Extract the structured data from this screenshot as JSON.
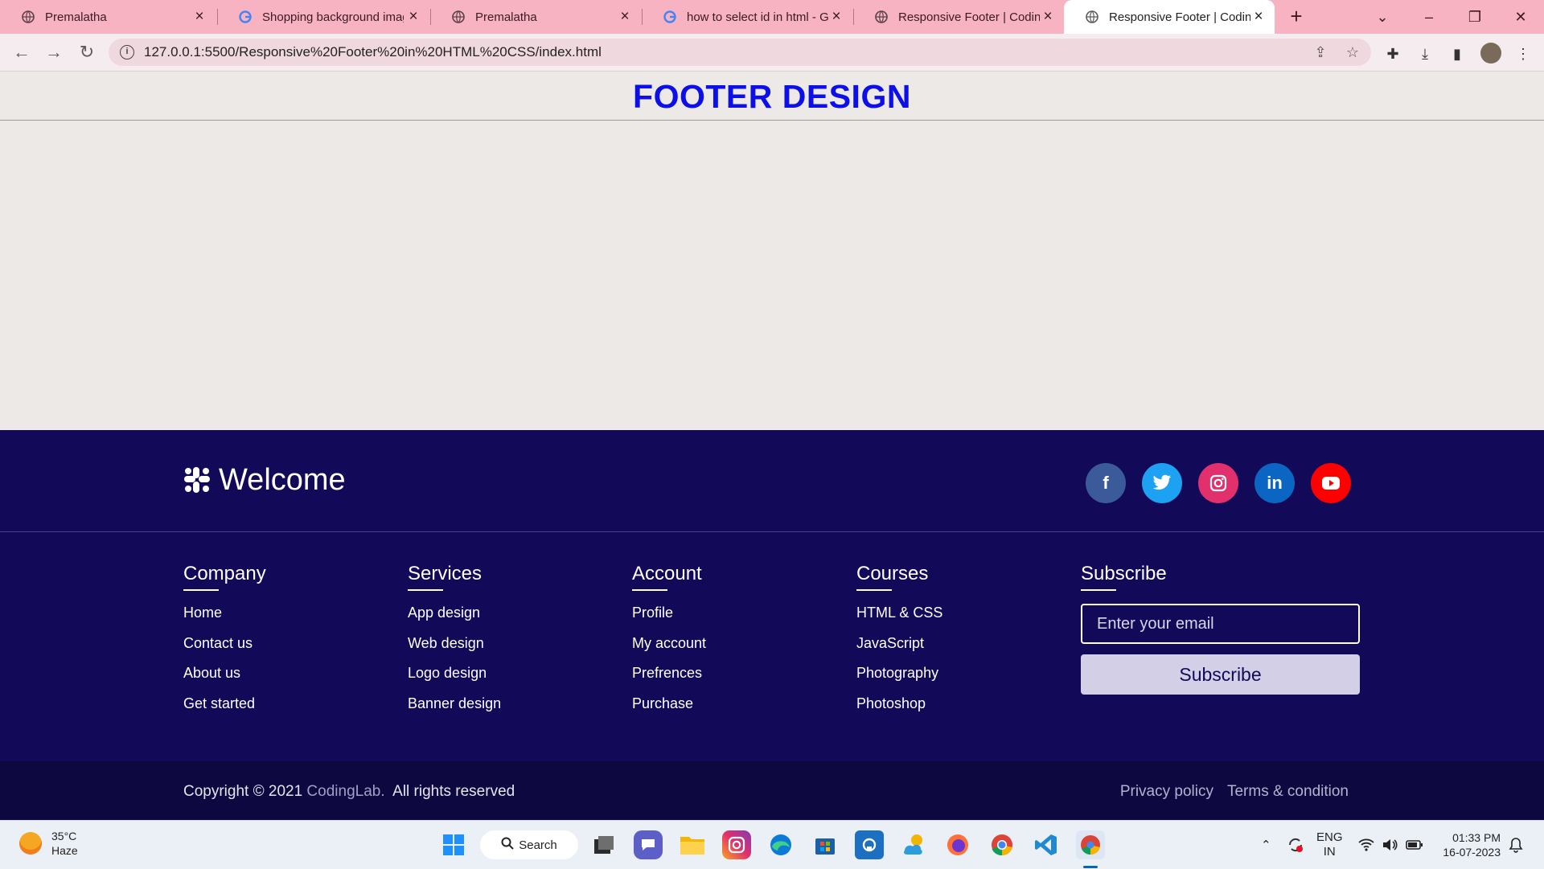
{
  "browser": {
    "tabs": [
      {
        "title": "Premalatha",
        "favicon": "globe-icon"
      },
      {
        "title": "Shopping background imag",
        "favicon": "google-icon"
      },
      {
        "title": "Premalatha",
        "favicon": "globe-icon"
      },
      {
        "title": "how to select id in html - G",
        "favicon": "google-icon"
      },
      {
        "title": "Responsive Footer | Coding",
        "favicon": "globe-icon"
      },
      {
        "title": "Responsive Footer | Coding",
        "favicon": "globe-icon",
        "active": true
      }
    ],
    "url": "127.0.0.1:5500/Responsive%20Footer%20in%20HTML%20CSS/index.html"
  },
  "page": {
    "heading": "FOOTER DESIGN"
  },
  "footer": {
    "logo_text": "Welcome",
    "socials": [
      {
        "name": "facebook",
        "glyph": "f",
        "color": "#3a5a9a"
      },
      {
        "name": "twitter",
        "glyph": "t",
        "color": "#1da1f2"
      },
      {
        "name": "instagram",
        "glyph": "◎",
        "color": "#e1306c"
      },
      {
        "name": "linkedin",
        "glyph": "in",
        "color": "#0a66c2"
      },
      {
        "name": "youtube",
        "glyph": "▶",
        "color": "#ff0000"
      }
    ],
    "columns": [
      {
        "title": "Company",
        "links": [
          "Home",
          "Contact us",
          "About us",
          "Get started"
        ]
      },
      {
        "title": "Services",
        "links": [
          "App design",
          "Web design",
          "Logo design",
          "Banner design"
        ]
      },
      {
        "title": "Account",
        "links": [
          "Profile",
          "My account",
          "Prefrences",
          "Purchase"
        ]
      },
      {
        "title": "Courses",
        "links": [
          "HTML & CSS",
          "JavaScript",
          "Photography",
          "Photoshop"
        ]
      }
    ],
    "subscribe": {
      "title": "Subscribe",
      "placeholder": "Enter your email",
      "button": "Subscribe"
    },
    "copyright_prefix": "Copyright © 2021",
    "copyright_brand": "CodingLab.",
    "copyright_suffix": "All rights reserved",
    "legal": [
      "Privacy policy",
      "Terms & condition"
    ]
  },
  "taskbar": {
    "temperature": "35°C",
    "weather": "Haze",
    "search": "Search",
    "lang_top": "ENG",
    "lang_bottom": "IN",
    "time": "01:33 PM",
    "date": "16-07-2023"
  },
  "colors": {
    "heading": "#0c0fe8",
    "footer_bg": "#120a59",
    "footer_bottom_bg": "#0d0840",
    "tabbar_bg": "#f7b3c2"
  }
}
